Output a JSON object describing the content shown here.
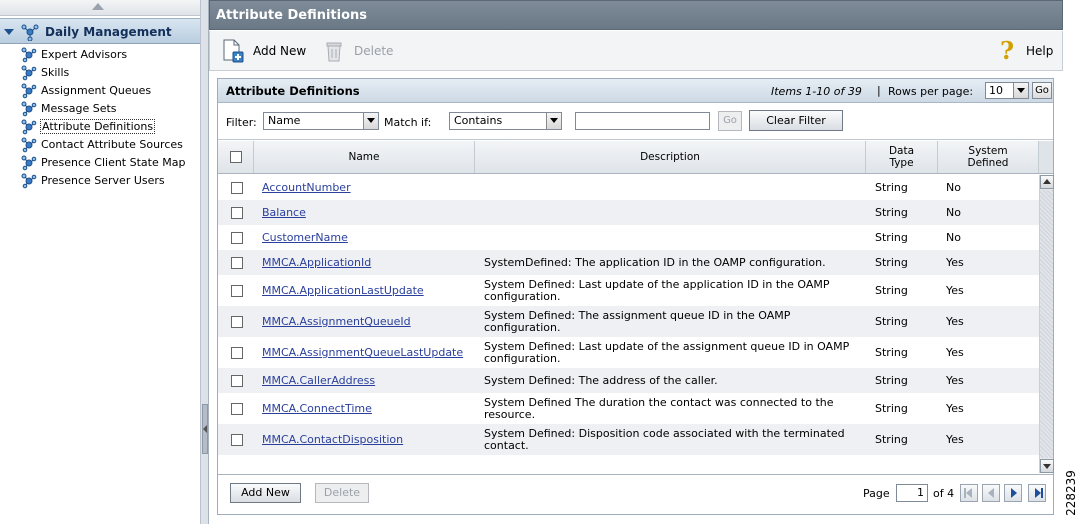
{
  "nav": {
    "header": "Daily Management",
    "items": [
      {
        "label": "Expert Advisors",
        "selected": false
      },
      {
        "label": "Skills",
        "selected": false
      },
      {
        "label": "Assignment Queues",
        "selected": false
      },
      {
        "label": "Message Sets",
        "selected": false
      },
      {
        "label": "Attribute Definitions",
        "selected": true
      },
      {
        "label": "Contact Attribute Sources",
        "selected": false
      },
      {
        "label": "Presence Client State Map",
        "selected": false
      },
      {
        "label": "Presence Server Users",
        "selected": false
      }
    ]
  },
  "page": {
    "title": "Attribute Definitions"
  },
  "toolbar": {
    "add_label": "Add New",
    "delete_label": "Delete",
    "help_label": "Help"
  },
  "panel": {
    "title": "Attribute Definitions",
    "items_info": "Items 1-10 of 39",
    "separator": "|",
    "rows_per_page_label": "Rows per page:",
    "rows_per_page": "10",
    "go_label": "Go"
  },
  "filter": {
    "label": "Filter:",
    "field": "Name",
    "match_label": "Match if:",
    "match": "Contains",
    "text": "",
    "go_label": "Go",
    "clear_label": "Clear Filter"
  },
  "columns": {
    "name": "Name",
    "description": "Description",
    "data_type": "Data Type",
    "system_defined": "System Defined"
  },
  "rows": [
    {
      "name": "AccountNumber",
      "description": "",
      "data_type": "String",
      "system_defined": "No"
    },
    {
      "name": "Balance",
      "description": "",
      "data_type": "String",
      "system_defined": "No"
    },
    {
      "name": "CustomerName",
      "description": "",
      "data_type": "String",
      "system_defined": "No"
    },
    {
      "name": "MMCA.ApplicationId",
      "description": "SystemDefined: The application ID in the OAMP configuration.",
      "data_type": "String",
      "system_defined": "Yes"
    },
    {
      "name": "MMCA.ApplicationLastUpdate",
      "description": "System Defined: Last update of the application ID in the OAMP configuration.",
      "data_type": "String",
      "system_defined": "Yes"
    },
    {
      "name": "MMCA.AssignmentQueueId",
      "description": "System Defined: The assignment queue ID in the OAMP configuration.",
      "data_type": "String",
      "system_defined": "Yes"
    },
    {
      "name": "MMCA.AssignmentQueueLastUpdate",
      "description": "System Defined: Last update of the assignment queue ID in OAMP configuration.",
      "data_type": "String",
      "system_defined": "Yes"
    },
    {
      "name": "MMCA.CallerAddress",
      "description": "System Defined: The address of the caller.",
      "data_type": "String",
      "system_defined": "Yes"
    },
    {
      "name": "MMCA.ConnectTime",
      "description": "System Defined The duration the contact was connected to the resource.",
      "data_type": "String",
      "system_defined": "Yes"
    },
    {
      "name": "MMCA.ContactDisposition",
      "description": "System Defined: Disposition code associated with the terminated contact.",
      "data_type": "String",
      "system_defined": "Yes"
    }
  ],
  "footer": {
    "add_label": "Add New",
    "delete_label": "Delete",
    "page_label": "Page",
    "page": "1",
    "of_label": "of 4"
  },
  "figure_id": "228239"
}
